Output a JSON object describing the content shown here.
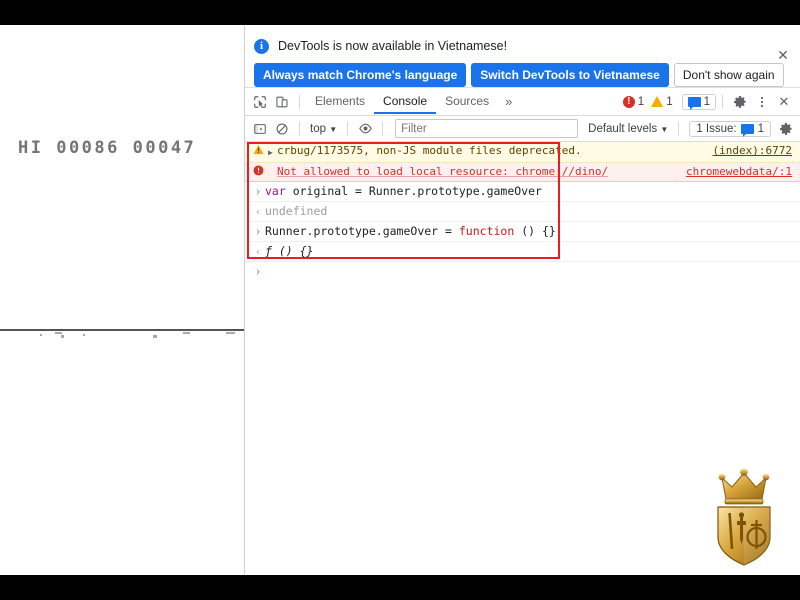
{
  "game": {
    "score_display": "HI 00086 00047",
    "high_score_label": "HI",
    "high_score": "00086",
    "current_score": "00047"
  },
  "locale_banner": {
    "info_icon": "info-icon",
    "message": "DevTools is now available in Vietnamese!",
    "primary_button": "Always match Chrome's language",
    "secondary_button": "Switch DevTools to Vietnamese",
    "dismiss_button": "Don't show again",
    "close_icon": "✕",
    "primary_color": "#1a73e8"
  },
  "tabbar": {
    "inspect_icon": "inspect-element-icon",
    "device_icon": "device-toolbar-icon",
    "tabs": [
      {
        "label": "Elements",
        "active": false
      },
      {
        "label": "Console",
        "active": true
      },
      {
        "label": "Sources",
        "active": false
      }
    ],
    "more_tabs": "»",
    "error_count": "1",
    "warning_count": "1",
    "issue_count": "1",
    "settings_icon": "gear-icon",
    "menu_icon": "kebab-menu-icon",
    "close_icon": "✕",
    "error_color": "#d93025",
    "warning_color": "#f9ab00",
    "issue_color": "#1a73e8"
  },
  "console_toolbar": {
    "sidebar_icon": "console-sidebar-icon",
    "clear_icon": "clear-console-icon",
    "context": "top",
    "context_caret": "▼",
    "eye_icon": "live-expression-eye-icon",
    "filter_placeholder": "Filter",
    "filter_value": "",
    "levels": "Default levels",
    "levels_caret": "▼",
    "issues_label": "1 Issue:",
    "issues_count": "1",
    "settings_icon": "console-settings-gear-icon"
  },
  "console_messages": [
    {
      "type": "warning",
      "icon": "warning-triangle-icon",
      "disclosure": "▶",
      "text": "crbug/1173575, non-JS module files deprecated.",
      "source": "(index):6772"
    },
    {
      "type": "error",
      "icon": "error-circle-icon",
      "disclosure": "",
      "text": "Not allowed to load local resource: chrome://dino/",
      "source": "chromewebdata/:1"
    }
  ],
  "console_evaluations": [
    {
      "kind": "input",
      "arrow": "›",
      "parts": [
        {
          "text": "var",
          "style": "kw"
        },
        {
          "text": " original = Runner.prototype.gameOver",
          "style": "op"
        }
      ],
      "plain": "var original = Runner.prototype.gameOver"
    },
    {
      "kind": "output",
      "arrow": "‹",
      "plain": "undefined"
    },
    {
      "kind": "input",
      "arrow": "›",
      "parts": [
        {
          "text": "Runner.prototype.gameOver = ",
          "style": "op"
        },
        {
          "text": "function",
          "style": "kw2"
        },
        {
          "text": " () {}",
          "style": "op"
        }
      ],
      "plain": "Runner.prototype.gameOver = function () {}"
    },
    {
      "kind": "output-fn",
      "arrow": "‹",
      "plain": "ƒ () {}"
    },
    {
      "kind": "prompt",
      "arrow": "›",
      "plain": ""
    }
  ],
  "annotation": {
    "shape": "rectangle",
    "color": "#ee1c1c"
  },
  "watermark": {
    "name": "crown-shield-emblem",
    "gold_light": "#f6d98a",
    "gold_mid": "#d6a33a",
    "gold_dark": "#9c6d13"
  }
}
